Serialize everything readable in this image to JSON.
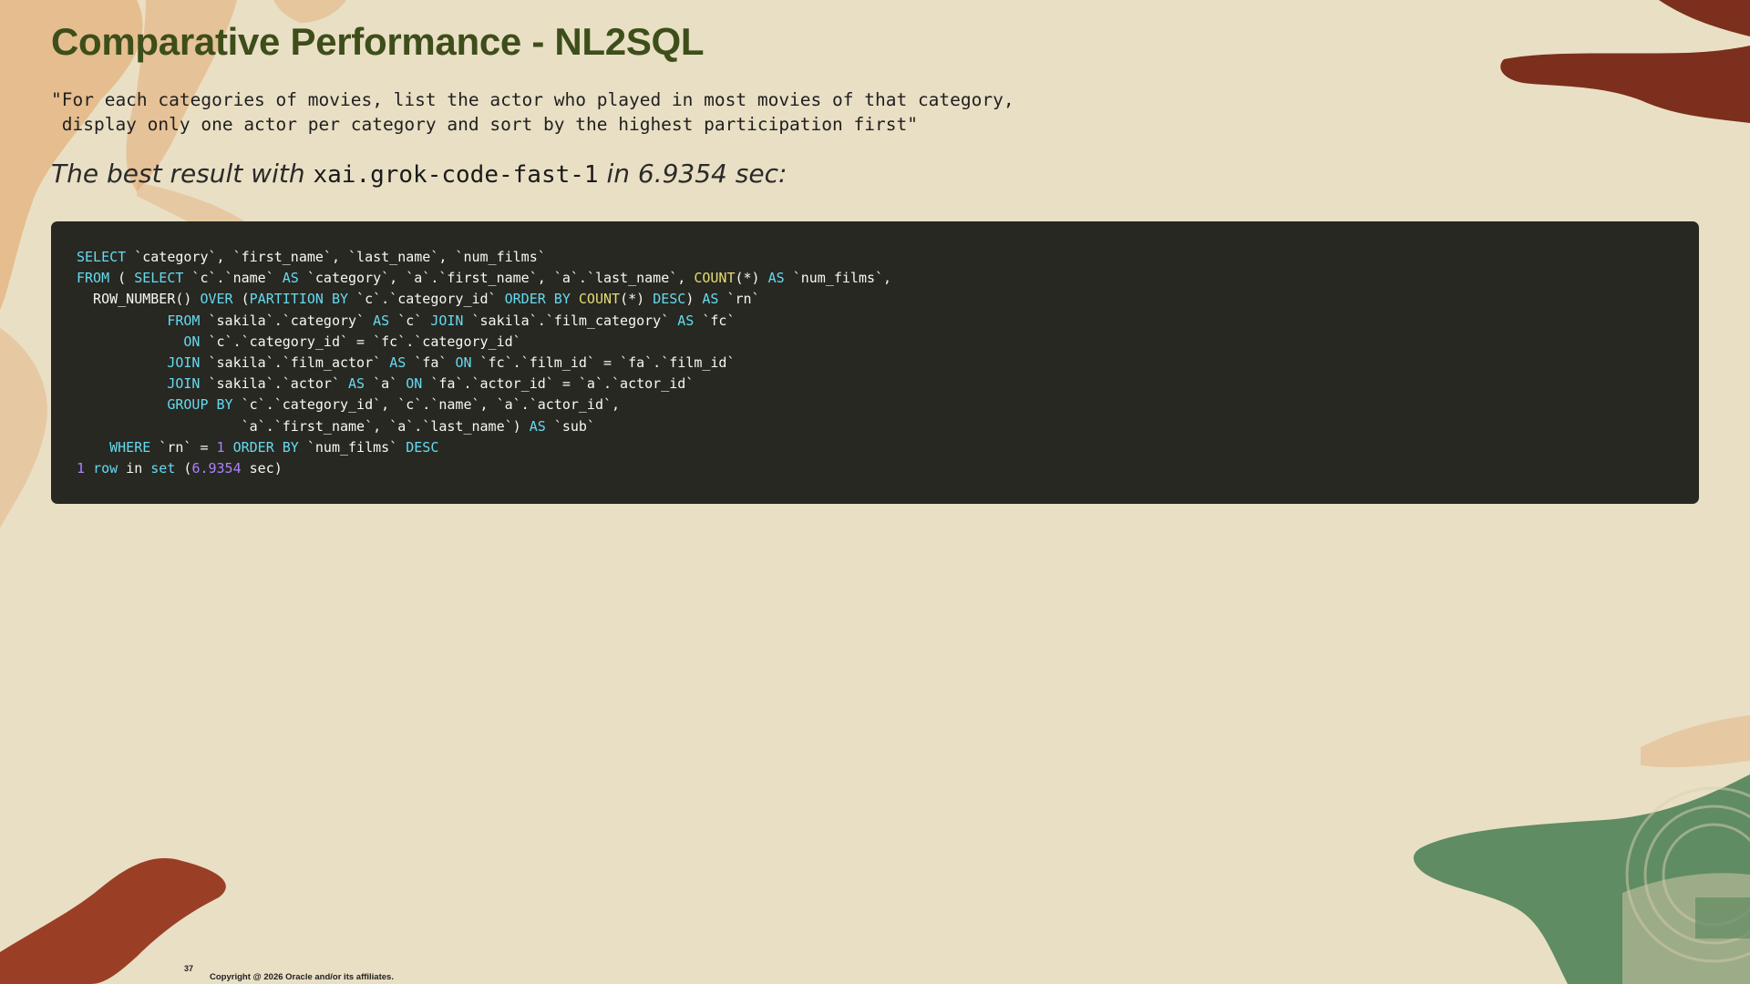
{
  "slide": {
    "title": "Comparative Performance - NL2SQL",
    "question_line1": "\"For each categories of movies, list the actor who played in most movies of that category,",
    "question_line2": " display only one actor per category and sort by the highest participation first\"",
    "result_prefix": "The best result with ",
    "result_model": "xai.grok-code-fast-1",
    "result_suffix": " in 6.9354 sec:",
    "page_number": "37",
    "copyright": "Copyright @ 2026 Oracle and/or its affiliates."
  },
  "code_lines": [
    [
      [
        "kw",
        "SELECT"
      ],
      [
        "t",
        " `category`, `first_name`, `last_name`, `num_films`"
      ]
    ],
    [
      [
        "kw",
        "FROM"
      ],
      [
        "t",
        " ( "
      ],
      [
        "kw",
        "SELECT"
      ],
      [
        "t",
        " `c`.`name` "
      ],
      [
        "kw",
        "AS"
      ],
      [
        "t",
        " `category`, `a`.`first_name`, `a`.`last_name`, "
      ],
      [
        "fn",
        "COUNT"
      ],
      [
        "t",
        "(*) "
      ],
      [
        "kw",
        "AS"
      ],
      [
        "t",
        " `num_films`,"
      ]
    ],
    [
      [
        "t",
        "  ROW_NUMBER() "
      ],
      [
        "kw",
        "OVER"
      ],
      [
        "t",
        " ("
      ],
      [
        "kw",
        "PARTITION BY"
      ],
      [
        "t",
        " `c`.`category_id` "
      ],
      [
        "kw",
        "ORDER BY"
      ],
      [
        "t",
        " "
      ],
      [
        "fn",
        "COUNT"
      ],
      [
        "t",
        "(*) "
      ],
      [
        "kw",
        "DESC"
      ],
      [
        "t",
        ") "
      ],
      [
        "kw",
        "AS"
      ],
      [
        "t",
        " `rn`"
      ]
    ],
    [
      [
        "t",
        "           "
      ],
      [
        "kw",
        "FROM"
      ],
      [
        "t",
        " `sakila`.`category` "
      ],
      [
        "kw",
        "AS"
      ],
      [
        "t",
        " `c` "
      ],
      [
        "kw",
        "JOIN"
      ],
      [
        "t",
        " `sakila`.`film_category` "
      ],
      [
        "kw",
        "AS"
      ],
      [
        "t",
        " `fc`"
      ]
    ],
    [
      [
        "t",
        "             "
      ],
      [
        "kw",
        "ON"
      ],
      [
        "t",
        " `c`.`category_id` = `fc`.`category_id`"
      ]
    ],
    [
      [
        "t",
        "           "
      ],
      [
        "kw",
        "JOIN"
      ],
      [
        "t",
        " `sakila`.`film_actor` "
      ],
      [
        "kw",
        "AS"
      ],
      [
        "t",
        " `fa` "
      ],
      [
        "kw",
        "ON"
      ],
      [
        "t",
        " `fc`.`film_id` = `fa`.`film_id`"
      ]
    ],
    [
      [
        "t",
        "           "
      ],
      [
        "kw",
        "JOIN"
      ],
      [
        "t",
        " `sakila`.`actor` "
      ],
      [
        "kw",
        "AS"
      ],
      [
        "t",
        " `a` "
      ],
      [
        "kw",
        "ON"
      ],
      [
        "t",
        " `fa`.`actor_id` = `a`.`actor_id`"
      ]
    ],
    [
      [
        "t",
        "           "
      ],
      [
        "kw",
        "GROUP BY"
      ],
      [
        "t",
        " `c`.`category_id`, `c`.`name`, `a`.`actor_id`,"
      ]
    ],
    [
      [
        "t",
        "                    `a`.`first_name`, `a`.`last_name`) "
      ],
      [
        "kw",
        "AS"
      ],
      [
        "t",
        " `sub`"
      ]
    ],
    [
      [
        "t",
        "    "
      ],
      [
        "kw",
        "WHERE"
      ],
      [
        "t",
        " `rn` = "
      ],
      [
        "num",
        "1"
      ],
      [
        "t",
        " "
      ],
      [
        "kw",
        "ORDER BY"
      ],
      [
        "t",
        " `num_films` "
      ],
      [
        "kw",
        "DESC"
      ]
    ],
    [
      [
        "num",
        "1"
      ],
      [
        "t",
        " "
      ],
      [
        "kw",
        "row"
      ],
      [
        "t",
        " in "
      ],
      [
        "kw",
        "set"
      ],
      [
        "t",
        " ("
      ],
      [
        "num",
        "6.9354"
      ],
      [
        "t",
        " sec)"
      ]
    ]
  ],
  "colors": {
    "background": "#e9dfc4",
    "title": "#3d4e1a",
    "code_bg": "#272822",
    "keyword": "#66d9ef",
    "function": "#e6db74",
    "number": "#ae81ff",
    "code_text": "#f8f8f2"
  }
}
